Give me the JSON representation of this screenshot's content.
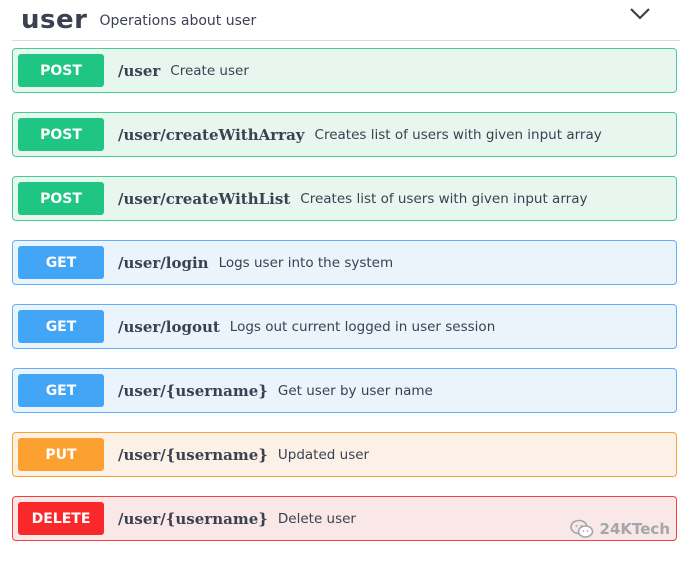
{
  "tag": {
    "name": "user",
    "description": "Operations about user"
  },
  "operations": [
    {
      "method": "POST",
      "path": "/user",
      "summary": "Create user"
    },
    {
      "method": "POST",
      "path": "/user/createWithArray",
      "summary": "Creates list of users with given input array"
    },
    {
      "method": "POST",
      "path": "/user/createWithList",
      "summary": "Creates list of users with given input array"
    },
    {
      "method": "GET",
      "path": "/user/login",
      "summary": "Logs user into the system"
    },
    {
      "method": "GET",
      "path": "/user/logout",
      "summary": "Logs out current logged in user session"
    },
    {
      "method": "GET",
      "path": "/user/{username}",
      "summary": "Get user by user name"
    },
    {
      "method": "PUT",
      "path": "/user/{username}",
      "summary": "Updated user"
    },
    {
      "method": "DELETE",
      "path": "/user/{username}",
      "summary": "Delete user"
    }
  ],
  "watermark": {
    "text": "24KTech",
    "icon": "wechat-icon"
  },
  "colors": {
    "post": "#49cc90",
    "get": "#61affe",
    "put": "#fca130",
    "delete": "#f93e3e"
  }
}
